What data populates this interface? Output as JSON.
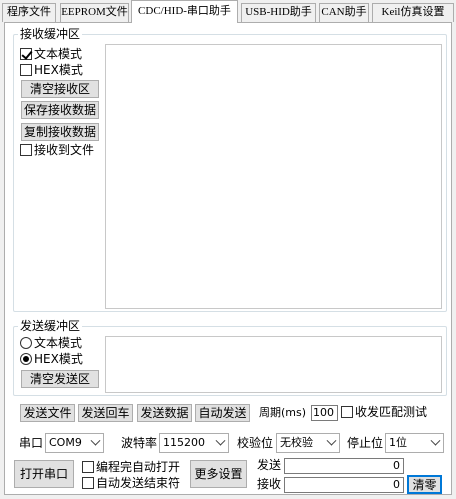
{
  "tabs": [
    {
      "label": "程序文件"
    },
    {
      "label": "EEPROM文件"
    },
    {
      "label": "CDC/HID-串口助手"
    },
    {
      "label": "USB-HID助手"
    },
    {
      "label": "CAN助手"
    },
    {
      "label": "Keil仿真设置"
    }
  ],
  "receive": {
    "group_title": "接收缓冲区",
    "text_mode_label": "文本模式",
    "text_mode_checked": true,
    "hex_mode_label": "HEX模式",
    "hex_mode_checked": false,
    "clear_button": "清空接收区",
    "save_button": "保存接收数据",
    "copy_button": "复制接收数据",
    "to_file_label": "接收到文件",
    "to_file_checked": false
  },
  "send": {
    "group_title": "发送缓冲区",
    "text_mode_label": "文本模式",
    "hex_mode_label": "HEX模式",
    "selected_mode": "hex",
    "clear_button": "清空发送区"
  },
  "send_toolbar": {
    "send_file": "发送文件",
    "send_return": "发送回车",
    "send_data": "发送数据",
    "auto_send": "自动发送",
    "period_label": "周期(ms)",
    "period_value": "100",
    "match_test_label": "收发匹配测试"
  },
  "serial": {
    "port_label": "串口",
    "port_value": "COM9",
    "baud_label": "波特率",
    "baud_value": "115200",
    "parity_label": "校验位",
    "parity_value": "无校验",
    "stop_label": "停止位",
    "stop_value": "1位"
  },
  "bottom": {
    "open_button": "打开串口",
    "auto_open_label": "编程完自动打开",
    "auto_end_label": "自动发送结束符",
    "more_button": "更多设置",
    "send_count_label": "发送",
    "send_count_value": "0",
    "recv_count_label": "接收",
    "recv_count_value": "0",
    "clear_count_button": "清零"
  }
}
